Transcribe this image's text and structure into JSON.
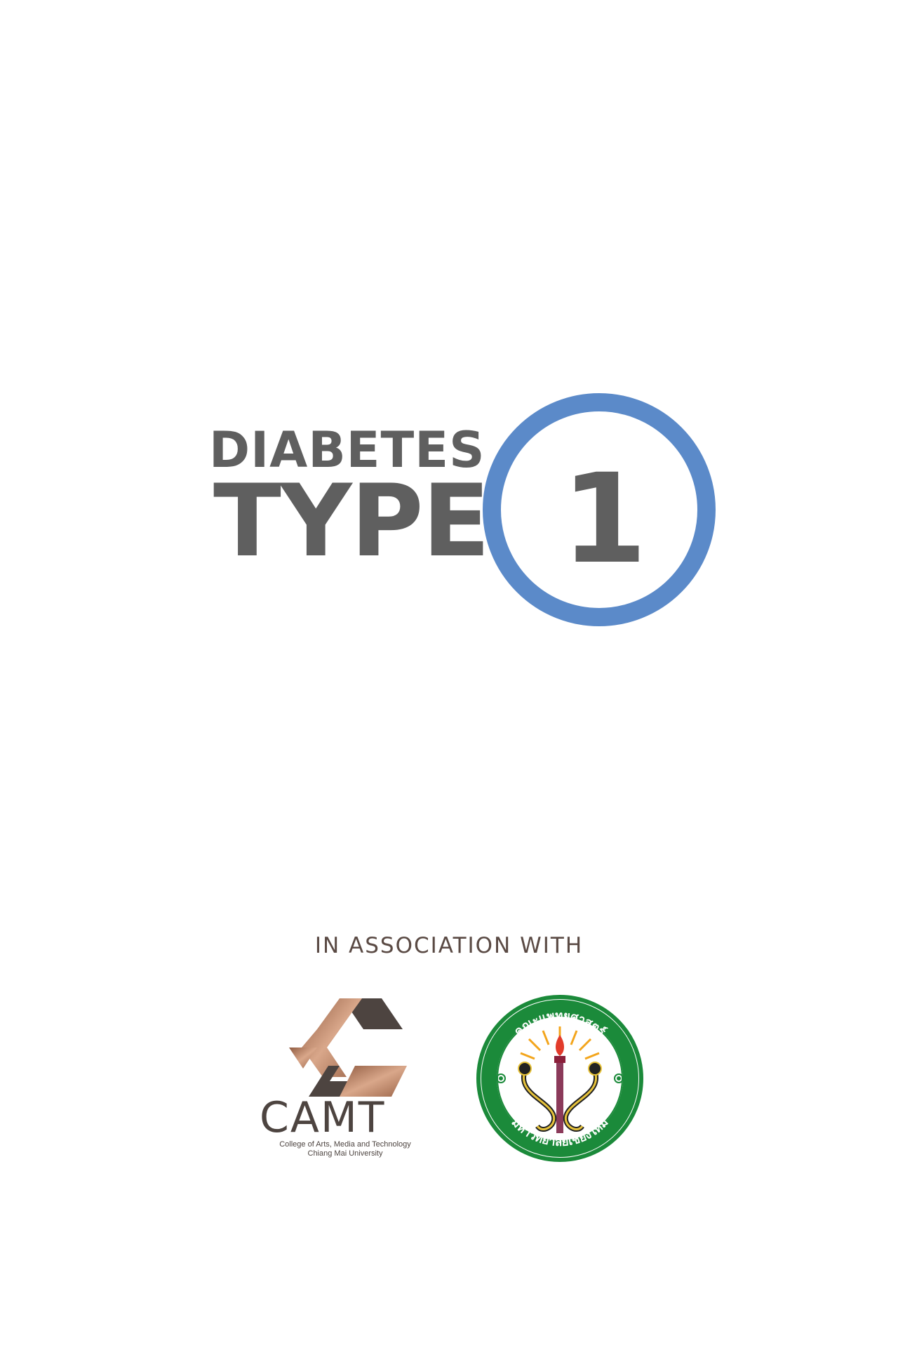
{
  "title": {
    "line1": "DIABETES",
    "line2": "TYPE",
    "numeral": "1"
  },
  "colors": {
    "title_text": "#5f5f5f",
    "ring": "#5b8ac9",
    "caption": "#5a4a44",
    "camt_copper": "#b07a5c",
    "camt_dark": "#4d4440",
    "seal_green": "#1b8a3a"
  },
  "association": {
    "caption": "IN ASSOCIATION WITH"
  },
  "partners": {
    "camt": {
      "wordmark": "CAMT",
      "caption_line1": "College of Arts, Media and Technology",
      "caption_line2": "Chiang Mai University"
    },
    "medicine": {
      "seal_top_text": "คณะแพทยศาสตร์",
      "seal_bottom_text": "มหาวิทยาลัยเชียงใหม่"
    }
  }
}
